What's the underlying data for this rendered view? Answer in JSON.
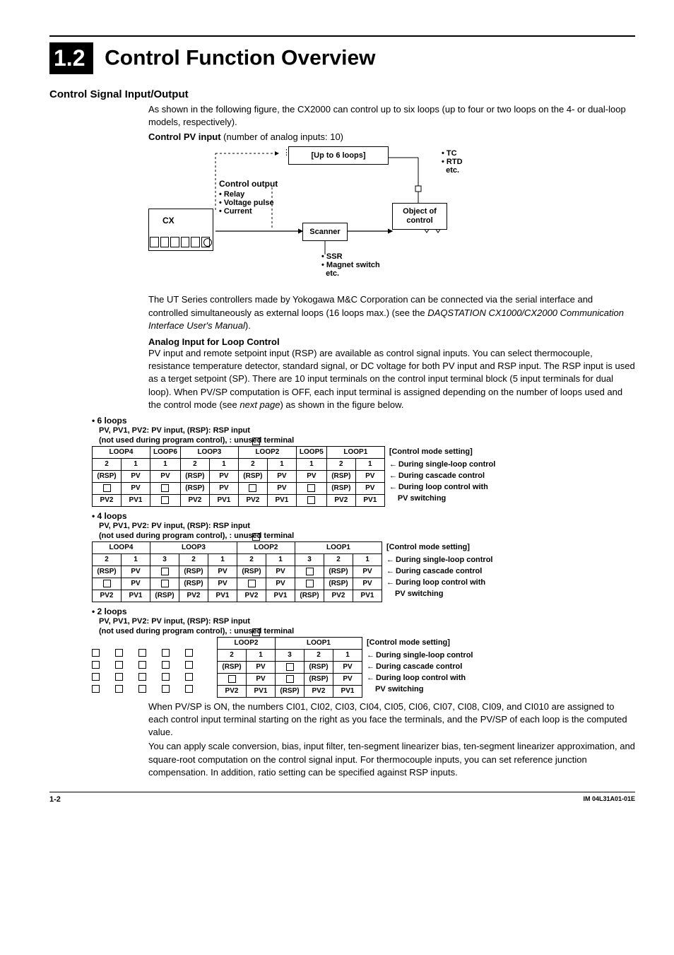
{
  "section": {
    "number": "1.2",
    "title": "Control Function Overview"
  },
  "subsection": {
    "title": "Control Signal Input/Output"
  },
  "intro1": "As shown in the following figure, the CX2000 can control up to six loops (up to four or two loops on the 4- or dual-loop models, respectively).",
  "pvInputCaption": "Control PV input",
  "pvInputCaptionSub": "(number of analog inputs: 10)",
  "diagram": {
    "cx": "CX",
    "upTo6": "[Up to 6 loops]",
    "controlOutput": "Control output",
    "outBullets": "• Relay\n• Voltage pulse\n• Current",
    "scanner": "Scanner",
    "obj": "Object of\ncontrol",
    "tcEtc": "• TC\n• RTD\n  etc.",
    "ssr": "• SSR\n• Magnet switch\n  etc."
  },
  "utText": "The UT Series controllers made by Yokogawa M&C Corporation can be connected via the serial interface and controlled simultaneously as external loops (16 loops max.) (see the ",
  "utManual": "DAQSTATION CX1000/CX2000 Communication Interface User's Manual",
  "analogTitle": "Analog Input for Loop Control",
  "analogPara": "PV input and remote setpoint input (RSP) are available as control signal inputs.  You can select thermocouple, resistance temperature detector, standard signal, or DC voltage for both PV input and RSP input.  The RSP input is used as a terget setpoint (SP).  There are 10 input terminals on the control input terminal block (5 input terminals for dual loop). When PV/SP computation is OFF, each input terminal is assigned depending on the number of loops used and the control mode (see ",
  "analogParaNext": "next page",
  "analogParaEnd": ") as shown in the figure below.",
  "loopSets": {
    "six": {
      "bullet": "• 6 loops",
      "line1": "PV, PV1, PV2: PV input, (RSP): RSP input",
      "line2": "(not used during program control),    : unused terminal",
      "groups": [
        "LOOP4",
        "LOOP6",
        "LOOP3",
        "LOOP2",
        "LOOP5",
        "LOOP1"
      ],
      "sub": [
        "2",
        "1",
        "1",
        "2",
        "1",
        "2",
        "1",
        "1",
        "2",
        "1"
      ],
      "rows": [
        [
          "(RSP)",
          "PV",
          "PV",
          "(RSP)",
          "PV",
          "(RSP)",
          "PV",
          "PV",
          "(RSP)",
          "PV"
        ],
        [
          "□",
          "PV",
          "□",
          "(RSP)",
          "PV",
          "□",
          "PV",
          "□",
          "(RSP)",
          "PV"
        ],
        [
          "PV2",
          "PV1",
          "□",
          "PV2",
          "PV1",
          "PV2",
          "PV1",
          "□",
          "PV2",
          "PV1"
        ]
      ]
    },
    "four": {
      "bullet": "• 4 loops",
      "line1": "PV, PV1, PV2: PV input, (RSP): RSP input",
      "line2": "(not used during program control),    : unused terminal",
      "groups": [
        "LOOP4",
        "LOOP3",
        "LOOP2",
        "LOOP1"
      ],
      "sub": [
        "2",
        "1",
        "3",
        "2",
        "1",
        "2",
        "1",
        "3",
        "2",
        "1"
      ],
      "rows": [
        [
          "(RSP)",
          "PV",
          "□",
          "(RSP)",
          "PV",
          "(RSP)",
          "PV",
          "□",
          "(RSP)",
          "PV"
        ],
        [
          "□",
          "PV",
          "□",
          "(RSP)",
          "PV",
          "□",
          "PV",
          "□",
          "(RSP)",
          "PV"
        ],
        [
          "PV2",
          "PV1",
          "(RSP)",
          "PV2",
          "PV1",
          "PV2",
          "PV1",
          "(RSP)",
          "PV2",
          "PV1"
        ]
      ]
    },
    "two": {
      "bullet": "• 2 loops",
      "line1": "PV, PV1, PV2: PV input, (RSP): RSP input",
      "line2": "(not used during program control),    : unused terminal",
      "groups": [
        "LOOP2",
        "LOOP1"
      ],
      "sub": [
        "2",
        "1",
        "3",
        "2",
        "1"
      ],
      "rows": [
        [
          "(RSP)",
          "PV",
          "□",
          "(RSP)",
          "PV"
        ],
        [
          "□",
          "PV",
          "□",
          "(RSP)",
          "PV"
        ],
        [
          "PV2",
          "PV1",
          "(RSP)",
          "PV2",
          "PV1"
        ]
      ]
    },
    "annot": {
      "header": "[Control mode setting]",
      "r1": "During single-loop control",
      "r2": "During cascade control",
      "r3a": "During loop control with",
      "r3b": "PV switching"
    }
  },
  "closing1": "When PV/SP is ON, the numbers CI01, CI02, CI03, CI04, CI05, CI06, CI07, CI08, CI09, and CI010 are assigned to each control input terminal starting on the right as you face the terminals, and the PV/SP of each loop is the computed value.",
  "closing2": "You can apply scale conversion, bias, input filter, ten-segment linearizer bias, ten-segment linearizer approximation, and square-root computation on the control signal input.  For thermocouple inputs, you can set reference junction compensation.  In addition, ratio setting can be specified against RSP inputs.",
  "footer": {
    "left": "1-2",
    "right": "IM 04L31A01-01E"
  }
}
